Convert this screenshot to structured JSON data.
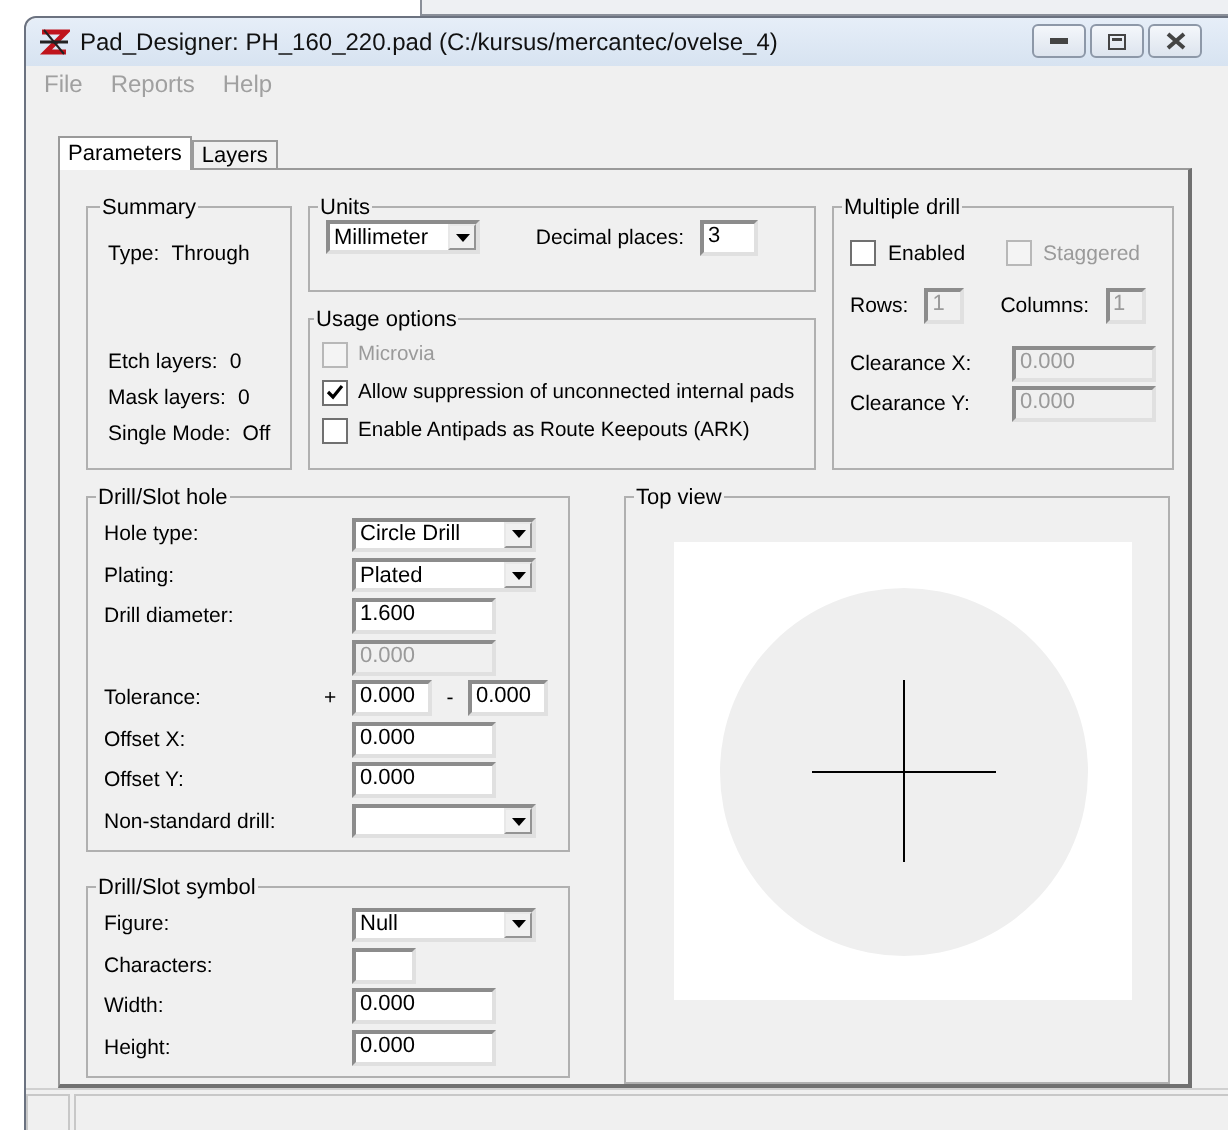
{
  "window": {
    "title": "Pad_Designer: PH_160_220.pad (C:/kursus/mercantec/ovelse_4)"
  },
  "menu": [
    {
      "label": "File",
      "disabled": true
    },
    {
      "label": "Reports",
      "disabled": true
    },
    {
      "label": "Help",
      "disabled": true
    }
  ],
  "tabs": [
    {
      "label": "Parameters",
      "selected": true
    },
    {
      "label": "Layers",
      "selected": false
    }
  ],
  "summary": {
    "title": "Summary",
    "rows": [
      {
        "label": "Type:",
        "value": "Through"
      },
      {
        "label": "Etch layers:",
        "value": "0"
      },
      {
        "label": "Mask layers:",
        "value": "0"
      },
      {
        "label": "Single Mode:",
        "value": "Off"
      }
    ]
  },
  "units": {
    "title": "Units",
    "unit": "Millimeter",
    "decimal_label": "Decimal places:",
    "decimal_value": "3"
  },
  "usage_options": {
    "title": "Usage options",
    "items": [
      {
        "label": "Microvia",
        "checked": false,
        "disabled": true
      },
      {
        "label": "Allow suppression of unconnected internal pads",
        "checked": true,
        "disabled": false
      },
      {
        "label": "Enable Antipads as Route Keepouts (ARK)",
        "checked": false,
        "disabled": false
      }
    ]
  },
  "multiple_drill": {
    "title": "Multiple drill",
    "checks": [
      {
        "label": "Enabled",
        "checked": false,
        "disabled": false
      },
      {
        "label": "Staggered",
        "checked": false,
        "disabled": true
      }
    ],
    "rows_label": "Rows:",
    "rows_value": "1",
    "columns_label": "Columns:",
    "columns_value": "1",
    "clearances": [
      {
        "label": "Clearance X:",
        "value": "0.000",
        "disabled": true
      },
      {
        "label": "Clearance Y:",
        "value": "0.000",
        "disabled": true
      }
    ]
  },
  "drill_slot_hole": {
    "title": "Drill/Slot hole",
    "rows": [
      {
        "kind": "dropdown",
        "label": "Hole type:",
        "value": "Circle Drill"
      },
      {
        "kind": "dropdown",
        "label": "Plating:",
        "value": "Plated"
      },
      {
        "kind": "field",
        "label": "Drill diameter:",
        "value": "1.600",
        "disabled": false
      },
      {
        "kind": "field",
        "value": "0.000",
        "disabled": true
      },
      {
        "kind": "tolerance",
        "label": "Tolerance:",
        "plus": "+",
        "value": "0.000",
        "minus": "-",
        "value2": "0.000"
      },
      {
        "kind": "field",
        "label": "Offset X:",
        "value": "0.000",
        "disabled": false
      },
      {
        "kind": "field",
        "label": "Offset Y:",
        "value": "0.000",
        "disabled": false
      },
      {
        "kind": "dropdown",
        "label": "Non-standard drill:"
      }
    ]
  },
  "drill_slot_symbol": {
    "title": "Drill/Slot symbol",
    "rows": [
      {
        "kind": "dropdown",
        "label": "Figure:",
        "value": "Null"
      },
      {
        "kind": "short_field",
        "label": "Characters:",
        "disabled": false
      },
      {
        "kind": "field",
        "label": "Width:",
        "value": "0.000",
        "disabled": false
      },
      {
        "kind": "field",
        "label": "Height:",
        "value": "0.000",
        "disabled": false
      }
    ]
  },
  "top_view": {
    "title": "Top view"
  }
}
